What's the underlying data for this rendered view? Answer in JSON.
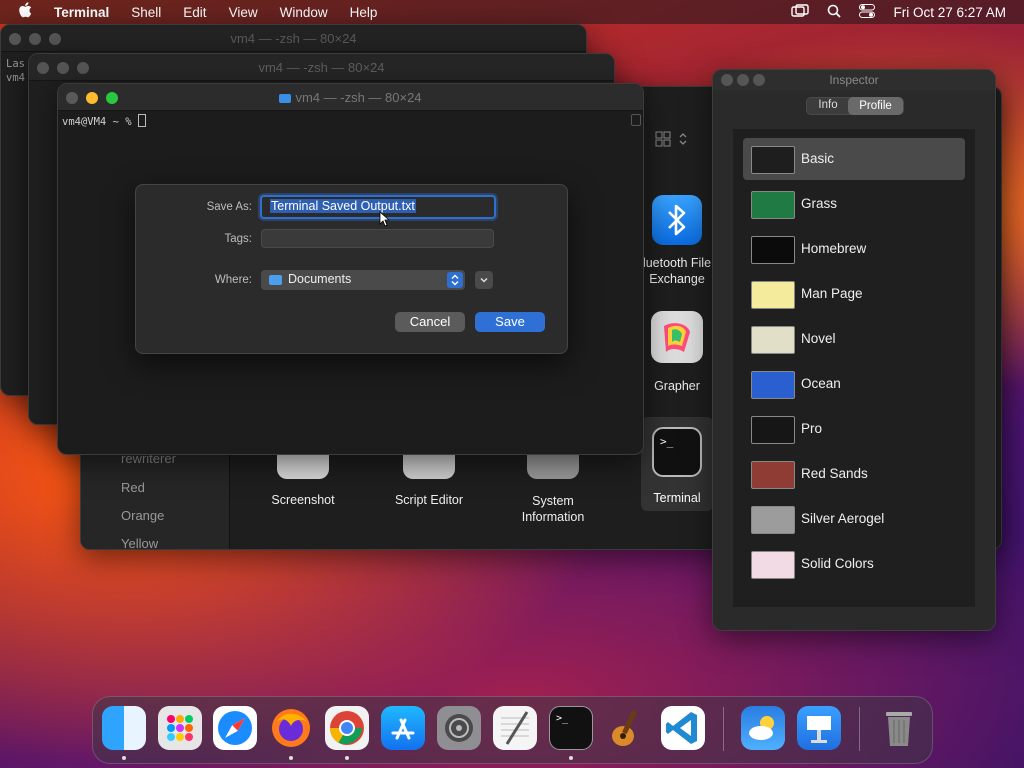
{
  "menubar": {
    "app": "Terminal",
    "items": [
      "Shell",
      "Edit",
      "View",
      "Window",
      "Help"
    ],
    "clock": "Fri Oct 27  6:27 AM"
  },
  "terminal_windows": {
    "title": "vm4 — -zsh — 80×24",
    "back_line1": "Las",
    "back_line2": "vm4",
    "prompt": "vm4@VM4 ~ % "
  },
  "save_dialog": {
    "save_as_label": "Save As:",
    "save_as_value": "Terminal Saved Output.txt",
    "tags_label": "Tags:",
    "tags_value": "",
    "where_label": "Where:",
    "where_value": "Documents",
    "cancel_label": "Cancel",
    "save_label": "Save"
  },
  "finder_bg": {
    "sidebar_items": [
      "rewriterer",
      "Red",
      "Orange",
      "Yellow"
    ],
    "apps": [
      {
        "label": "Screenshot"
      },
      {
        "label": "Script Editor"
      },
      {
        "label": "System\nInformation"
      },
      {
        "label": "Terminal"
      }
    ],
    "right_apps": [
      {
        "label": "luetooth File\nExchange"
      },
      {
        "label": "Grapher"
      }
    ]
  },
  "inspector": {
    "title": "Inspector",
    "tabs": [
      "Info",
      "Profile"
    ],
    "selected_tab": "Profile",
    "profiles": [
      {
        "name": "Basic",
        "color": "#1e1e1e"
      },
      {
        "name": "Grass",
        "color": "#1f7a43"
      },
      {
        "name": "Homebrew",
        "color": "#0b0b0b"
      },
      {
        "name": "Man Page",
        "color": "#f4ec9c"
      },
      {
        "name": "Novel",
        "color": "#e2dfc8"
      },
      {
        "name": "Ocean",
        "color": "#2a5fcf"
      },
      {
        "name": "Pro",
        "color": "#161616"
      },
      {
        "name": "Red Sands",
        "color": "#8e3c34"
      },
      {
        "name": "Silver Aerogel",
        "color": "#9c9c9c"
      },
      {
        "name": "Solid Colors",
        "color": "#f3dbe6"
      }
    ],
    "selected_profile": "Basic"
  },
  "dock": {
    "icons": [
      "finder-icon",
      "launchpad-icon",
      "safari-icon",
      "firefox-icon",
      "chrome-icon",
      "app-store-icon",
      "system-settings-icon",
      "textedit-icon",
      "terminal-icon",
      "garageband-icon",
      "vscode-icon",
      "weather-icon",
      "keynote-icon",
      "trash-icon"
    ]
  }
}
